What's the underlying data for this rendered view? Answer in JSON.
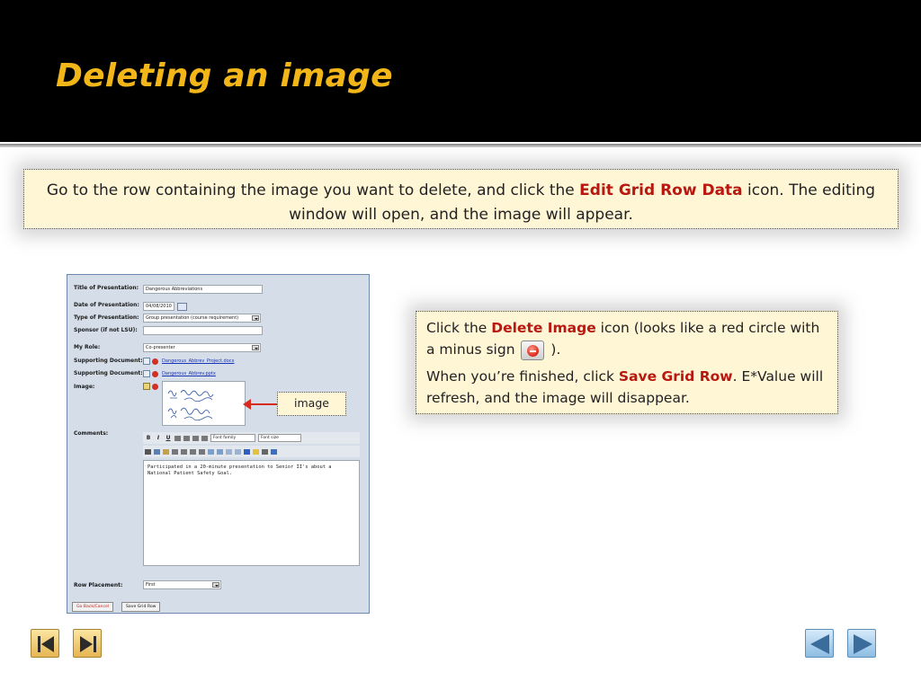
{
  "slide": {
    "title": "Deleting an image",
    "top_callout": {
      "before": "Go to the row containing the image you want to delete, and click the ",
      "highlight": "Edit Grid Row Data",
      "after": " icon.  The editing window will open, and the image will appear."
    },
    "right_callout": {
      "p1_before": "Click the ",
      "p1_highlight": "Delete Image",
      "p1_after": " icon (looks like a red circle with a minus sign ",
      "p1_end": ").",
      "p2_before": "When you’re finished, click ",
      "p2_highlight": "Save Grid Row",
      "p2_after": ".  E*Value will refresh, and the image will disappear."
    },
    "image_label": "image",
    "colors": {
      "title": "#f2b619",
      "highlight": "#b8180f",
      "callout_bg": "#fff6d6"
    }
  },
  "form": {
    "title_label": "Title of Presentation:",
    "title_value": "Dangerous Abbreviations",
    "date_label": "Date of Presentation:",
    "date_value": "04/08/2010",
    "type_label": "Type of Presentation:",
    "type_value": "Group presentation (course requirement)",
    "sponsor_label": "Sponsor (if not LSU):",
    "sponsor_value": "",
    "role_label": "My Role:",
    "role_value": "Co-presenter",
    "doc1_label": "Supporting Document:",
    "doc1_value": "Dangerous_Abbrev_Project.docx",
    "doc2_label": "Supporting Document:",
    "doc2_value": "Dangerous_Abbrev.pptx",
    "image_label": "Image:",
    "comments_label": "Comments:",
    "toolbar_font_family": "Font family",
    "toolbar_font_size": "Font size",
    "comment_text": "Participated in a 20-minute presentation to Senior II's about a National Patient Safety Goal.",
    "row_placement_label": "Row Placement:",
    "row_placement_value": "First",
    "back_button": "Go Back/Cancel",
    "save_button": "Save Grid Row"
  },
  "icons": {
    "delete": "red-circle-minus-icon",
    "nav": [
      "first-slide-icon",
      "last-slide-icon",
      "previous-slide-icon",
      "next-slide-icon"
    ]
  }
}
